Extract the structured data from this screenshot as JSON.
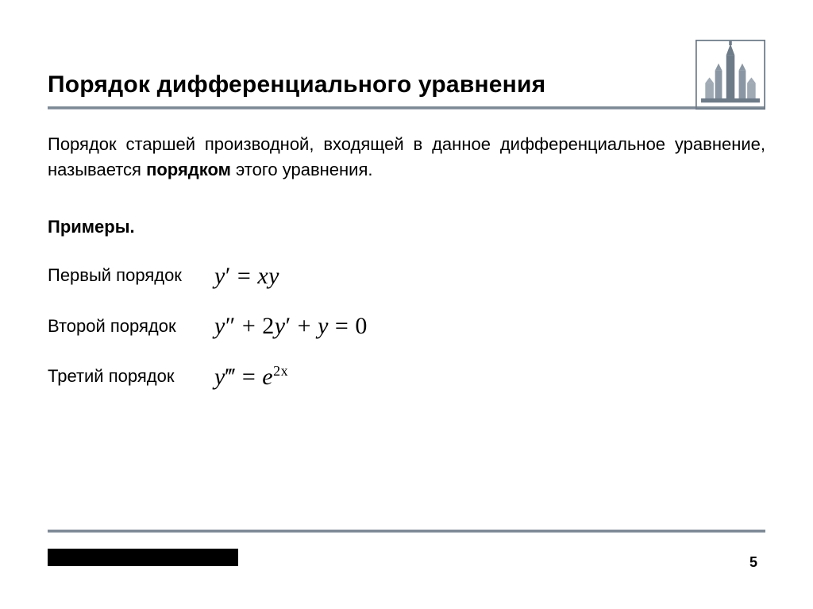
{
  "title": "Порядок дифференциального уравнения",
  "definition": {
    "pre": "Порядок старшей производной, входящей в данное дифференциальное уравнение, называется ",
    "bold": "порядком",
    "post": " этого уравнения."
  },
  "examples_label": "Примеры",
  "examples": [
    {
      "label": "Первый порядок"
    },
    {
      "label": "Второй порядок"
    },
    {
      "label": "Третий порядок"
    }
  ],
  "formulas": {
    "first": {
      "lhs_var": "y",
      "lhs_primes": "′",
      "eq": " = ",
      "rhs": "xy"
    },
    "second": {
      "t1_var": "y",
      "t1_primes": "″",
      "plus1": " + ",
      "coef": "2",
      "t2_var": "y",
      "t2_primes": "′",
      "plus2": " + ",
      "t3_var": "y",
      "eq": " = ",
      "zero": "0"
    },
    "third": {
      "lhs_var": "y",
      "lhs_primes": "‴",
      "eq": " = ",
      "e": "e",
      "exp_coef": "2",
      "exp_var": "x"
    }
  },
  "page_number": "5",
  "logo_alt": "msu-building-icon"
}
